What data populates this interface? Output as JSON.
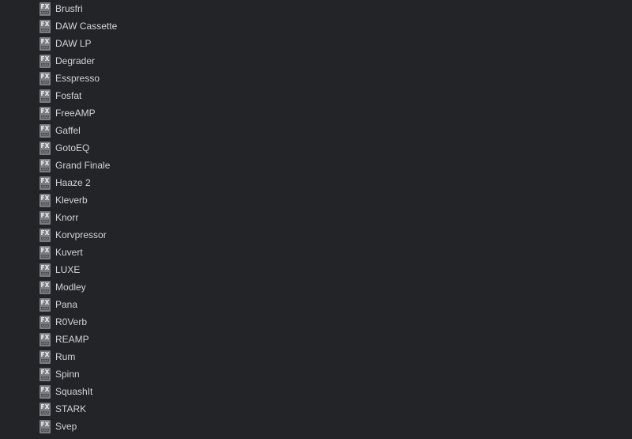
{
  "colors": {
    "background": "#232428",
    "text": "#d3d4d8",
    "icon_fill": "#7a7c82",
    "icon_text": "#eceef2"
  },
  "icon_name": "fx-plugin-icon",
  "icon_label": "FX",
  "plugins": [
    "Brusfri",
    "DAW Cassette",
    "DAW LP",
    "Degrader",
    "Esspresso",
    "Fosfat",
    "FreeAMP",
    "Gaffel",
    "GotoEQ",
    "Grand Finale",
    "Haaze 2",
    "Kleverb",
    "Knorr",
    "Korvpressor",
    "Kuvert",
    "LUXE",
    "Modley",
    "Pana",
    "R0Verb",
    "REAMP",
    "Rum",
    "Spinn",
    "SquashIt",
    "STARK",
    "Svep"
  ]
}
